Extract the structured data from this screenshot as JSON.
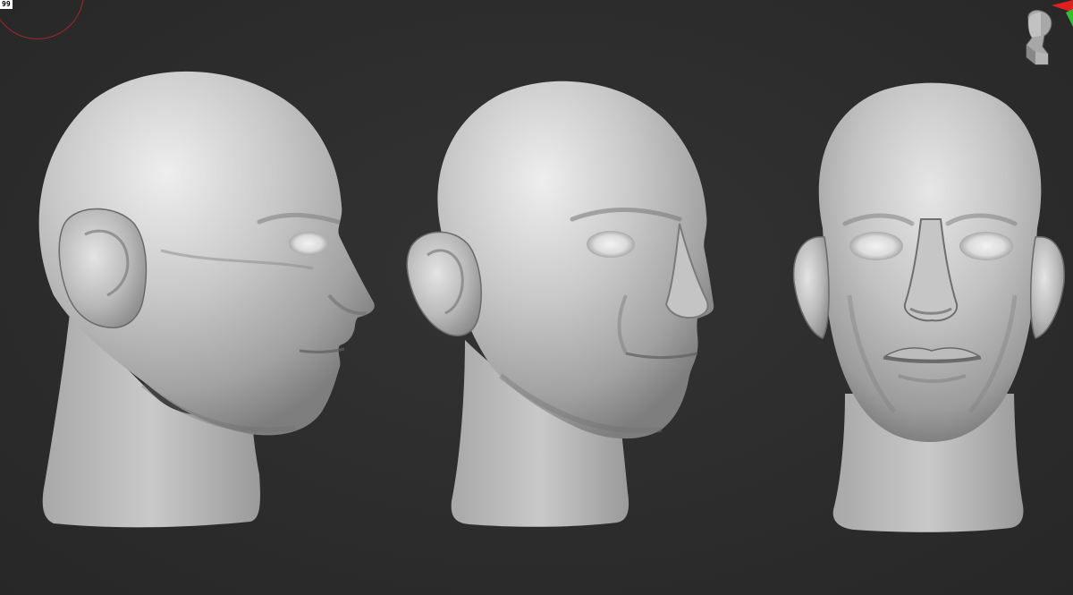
{
  "app": {
    "view_type": "3D sculpt viewport",
    "background_color": "#2b2b2b"
  },
  "hud": {
    "fps_text": "99"
  },
  "gizmo": {
    "icon": "head-orientation-icon",
    "axis_x_color": "#e02020",
    "axis_y_color": "#30c030"
  },
  "models": [
    {
      "name": "head-profile-view",
      "view": "side",
      "material_color": "#bdbdbd"
    },
    {
      "name": "head-three-quarter-view",
      "view": "three-quarter",
      "material_color": "#bdbdbd"
    },
    {
      "name": "head-front-view",
      "view": "front",
      "material_color": "#bdbdbd"
    }
  ]
}
